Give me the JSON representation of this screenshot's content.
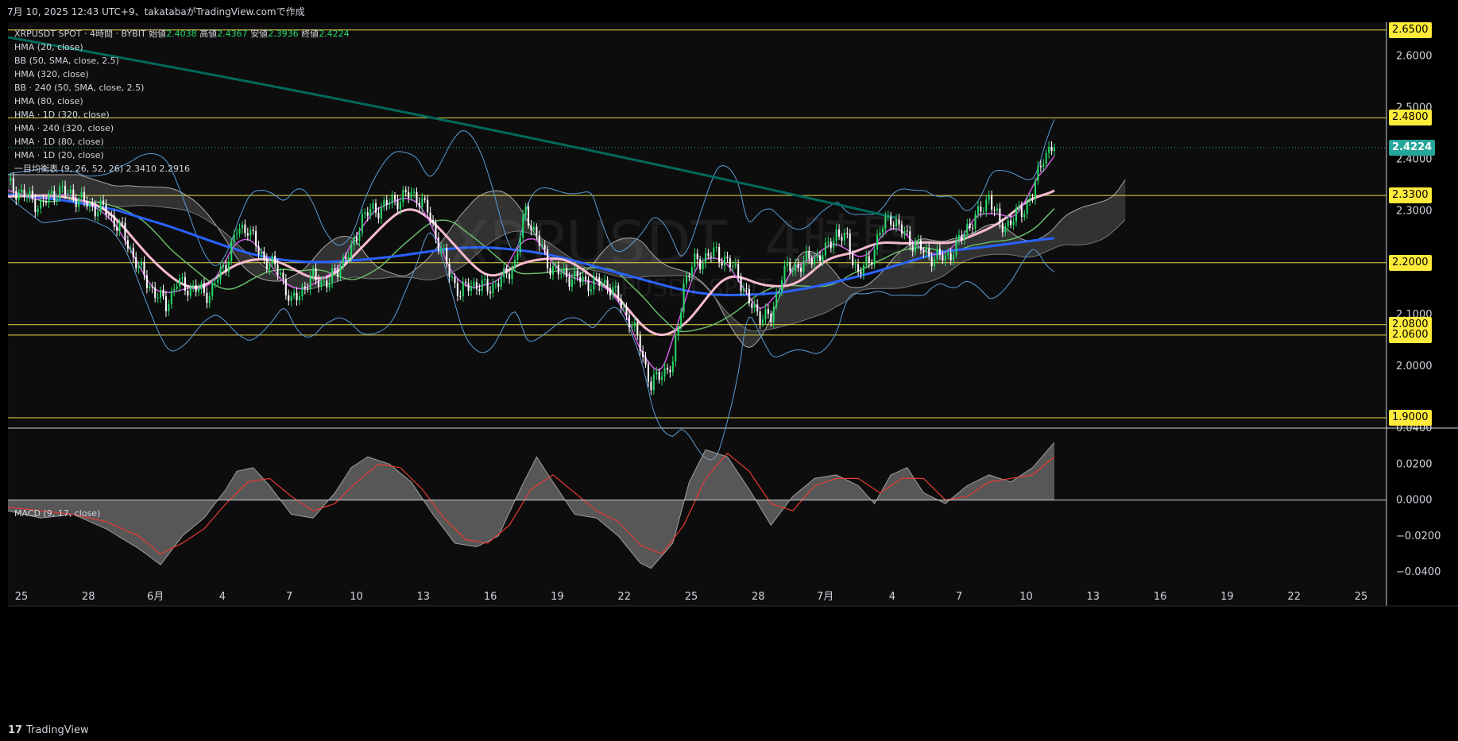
{
  "header": {
    "title": "7月 10, 2025 12:43 UTC+9、takatabaがTradingView.comで作成"
  },
  "legend": {
    "symbol": "XRPUSDT SPOT · 4時間 · BYBIT",
    "ohlc_labels": {
      "open": "始値",
      "high": "高値",
      "low": "安値",
      "close": "終値"
    },
    "ohlc_values": {
      "open": "2.4038",
      "high": "2.4367",
      "low": "2.3936",
      "close": "2.4224"
    },
    "indicators": [
      "HMA (20, close)",
      "BB (50, SMA, close, 2.5)",
      "HMA (320, close)",
      "BB · 240 (50, SMA, close, 2.5)",
      "HMA (80, close)",
      "HMA · 1D (320, close)",
      "HMA · 240 (320, close)",
      "HMA · 1D (80, close)",
      "HMA · 1D (20, close)"
    ],
    "ichimoku": "一目均衡表 (9, 26, 52, 26)",
    "ichimoku_values": "2.3410  2.2916"
  },
  "watermark": {
    "main": "XRPUSDT, 4時間",
    "sub": "XRPUSDT SPOT"
  },
  "macd_legend": "MACD (9, 17, close)",
  "footer": {
    "brand": "TradingView",
    "mark": "17"
  },
  "colors": {
    "background": "#0d0d0d",
    "candle_up": "#26d968",
    "candle_down": "#ffffff",
    "hline": "#e8d94a",
    "hma320": "#2962ff",
    "hma80": "#f8bbd0",
    "hma20": "#d05ce3",
    "long_hma": "#00695c",
    "bb": "#5b9bd5",
    "green_ma": "#66bb6a",
    "price_tag": "#ffeb3b",
    "last_tag": "#26a69a"
  },
  "chart_data": [
    {
      "type": "candlestick",
      "symbol": "XRPUSDT SPOT",
      "timeframe": "4時間",
      "y_axis_ticks": [
        "2.6000",
        "2.5000",
        "2.4000",
        "2.3000",
        "2.1000",
        "2.0000"
      ],
      "ylim": [
        1.88,
        2.665
      ],
      "x_axis_ticks": [
        "25",
        "28",
        "6月",
        "4",
        "7",
        "10",
        "13",
        "16",
        "19",
        "22",
        "25",
        "28",
        "7月",
        "4",
        "7",
        "10",
        "13",
        "16",
        "19",
        "22",
        "25"
      ],
      "horizontal_lines": [
        2.65,
        2.48,
        2.33,
        2.2,
        2.08,
        2.06,
        1.9
      ],
      "price_labels": [
        "2.6500",
        "2.4800",
        "2.3300",
        "2.2000",
        "2.0800",
        "2.0600",
        "1.9000"
      ],
      "last_price": "2.4224",
      "path_points": [
        [
          0,
          2.35
        ],
        [
          6,
          2.33
        ],
        [
          12,
          2.31
        ],
        [
          18,
          2.34
        ],
        [
          24,
          2.33
        ],
        [
          30,
          2.31
        ],
        [
          36,
          2.3
        ],
        [
          42,
          2.26
        ],
        [
          48,
          2.19
        ],
        [
          54,
          2.14
        ],
        [
          58,
          2.12
        ],
        [
          62,
          2.16
        ],
        [
          68,
          2.15
        ],
        [
          74,
          2.14
        ],
        [
          80,
          2.2
        ],
        [
          84,
          2.26
        ],
        [
          88,
          2.27
        ],
        [
          92,
          2.22
        ],
        [
          96,
          2.2
        ],
        [
          100,
          2.18
        ],
        [
          104,
          2.12
        ],
        [
          108,
          2.15
        ],
        [
          112,
          2.17
        ],
        [
          118,
          2.16
        ],
        [
          122,
          2.2
        ],
        [
          126,
          2.22
        ],
        [
          130,
          2.29
        ],
        [
          134,
          2.3
        ],
        [
          138,
          2.31
        ],
        [
          142,
          2.32
        ],
        [
          146,
          2.33
        ],
        [
          150,
          2.33
        ],
        [
          154,
          2.3
        ],
        [
          158,
          2.24
        ],
        [
          162,
          2.18
        ],
        [
          166,
          2.14
        ],
        [
          170,
          2.16
        ],
        [
          176,
          2.15
        ],
        [
          182,
          2.17
        ],
        [
          186,
          2.2
        ],
        [
          190,
          2.3
        ],
        [
          194,
          2.25
        ],
        [
          198,
          2.2
        ],
        [
          202,
          2.18
        ],
        [
          208,
          2.17
        ],
        [
          214,
          2.16
        ],
        [
          220,
          2.16
        ],
        [
          224,
          2.13
        ],
        [
          228,
          2.09
        ],
        [
          232,
          2.04
        ],
        [
          236,
          1.96
        ],
        [
          240,
          1.99
        ],
        [
          244,
          2.0
        ],
        [
          248,
          2.16
        ],
        [
          252,
          2.2
        ],
        [
          256,
          2.21
        ],
        [
          260,
          2.22
        ],
        [
          264,
          2.2
        ],
        [
          268,
          2.18
        ],
        [
          272,
          2.12
        ],
        [
          276,
          2.1
        ],
        [
          280,
          2.09
        ],
        [
          284,
          2.18
        ],
        [
          288,
          2.19
        ],
        [
          292,
          2.2
        ],
        [
          296,
          2.21
        ],
        [
          300,
          2.22
        ],
        [
          304,
          2.26
        ],
        [
          308,
          2.24
        ],
        [
          312,
          2.18
        ],
        [
          316,
          2.2
        ],
        [
          320,
          2.26
        ],
        [
          324,
          2.29
        ],
        [
          328,
          2.26
        ],
        [
          332,
          2.24
        ],
        [
          336,
          2.22
        ],
        [
          340,
          2.21
        ],
        [
          344,
          2.21
        ],
        [
          348,
          2.23
        ],
        [
          352,
          2.27
        ],
        [
          356,
          2.29
        ],
        [
          360,
          2.33
        ],
        [
          364,
          2.27
        ],
        [
          368,
          2.28
        ],
        [
          372,
          2.3
        ],
        [
          376,
          2.33
        ],
        [
          380,
          2.41
        ],
        [
          384,
          2.4224
        ]
      ]
    },
    {
      "type": "area",
      "name": "MACD (9, 17, close)",
      "y_axis_ticks": [
        "0.0400",
        "0.0200",
        "0.0000",
        "−0.0200",
        "−0.0400"
      ],
      "ylim": [
        -0.047,
        0.04
      ],
      "macd_points": [
        [
          0,
          -0.006
        ],
        [
          12,
          -0.01
        ],
        [
          24,
          -0.008
        ],
        [
          36,
          -0.016
        ],
        [
          48,
          -0.027
        ],
        [
          56,
          -0.036
        ],
        [
          64,
          -0.02
        ],
        [
          72,
          -0.01
        ],
        [
          80,
          0.006
        ],
        [
          84,
          0.016
        ],
        [
          90,
          0.018
        ],
        [
          96,
          0.008
        ],
        [
          104,
          -0.008
        ],
        [
          112,
          -0.01
        ],
        [
          120,
          0.004
        ],
        [
          126,
          0.018
        ],
        [
          132,
          0.024
        ],
        [
          140,
          0.02
        ],
        [
          148,
          0.01
        ],
        [
          156,
          -0.008
        ],
        [
          164,
          -0.024
        ],
        [
          172,
          -0.026
        ],
        [
          180,
          -0.02
        ],
        [
          188,
          0.006
        ],
        [
          194,
          0.024
        ],
        [
          200,
          0.01
        ],
        [
          208,
          -0.008
        ],
        [
          216,
          -0.01
        ],
        [
          224,
          -0.02
        ],
        [
          232,
          -0.035
        ],
        [
          236,
          -0.038
        ],
        [
          244,
          -0.024
        ],
        [
          250,
          0.01
        ],
        [
          256,
          0.028
        ],
        [
          264,
          0.024
        ],
        [
          272,
          0.006
        ],
        [
          280,
          -0.014
        ],
        [
          288,
          0.002
        ],
        [
          296,
          0.012
        ],
        [
          304,
          0.014
        ],
        [
          312,
          0.008
        ],
        [
          318,
          -0.002
        ],
        [
          324,
          0.014
        ],
        [
          330,
          0.018
        ],
        [
          336,
          0.004
        ],
        [
          344,
          -0.002
        ],
        [
          352,
          0.008
        ],
        [
          360,
          0.014
        ],
        [
          368,
          0.01
        ],
        [
          376,
          0.018
        ],
        [
          384,
          0.032
        ]
      ],
      "signal_points": [
        [
          0,
          -0.004
        ],
        [
          12,
          -0.006
        ],
        [
          24,
          -0.008
        ],
        [
          36,
          -0.012
        ],
        [
          48,
          -0.02
        ],
        [
          56,
          -0.03
        ],
        [
          64,
          -0.024
        ],
        [
          72,
          -0.016
        ],
        [
          80,
          -0.002
        ],
        [
          88,
          0.01
        ],
        [
          96,
          0.012
        ],
        [
          104,
          0.002
        ],
        [
          112,
          -0.006
        ],
        [
          120,
          -0.002
        ],
        [
          128,
          0.01
        ],
        [
          136,
          0.02
        ],
        [
          144,
          0.018
        ],
        [
          152,
          0.006
        ],
        [
          160,
          -0.01
        ],
        [
          168,
          -0.022
        ],
        [
          176,
          -0.024
        ],
        [
          184,
          -0.014
        ],
        [
          192,
          0.006
        ],
        [
          200,
          0.014
        ],
        [
          208,
          0.004
        ],
        [
          216,
          -0.006
        ],
        [
          224,
          -0.012
        ],
        [
          232,
          -0.025
        ],
        [
          240,
          -0.03
        ],
        [
          248,
          -0.014
        ],
        [
          256,
          0.012
        ],
        [
          264,
          0.026
        ],
        [
          272,
          0.016
        ],
        [
          280,
          -0.002
        ],
        [
          288,
          -0.006
        ],
        [
          296,
          0.008
        ],
        [
          304,
          0.012
        ],
        [
          312,
          0.012
        ],
        [
          320,
          0.004
        ],
        [
          328,
          0.012
        ],
        [
          336,
          0.012
        ],
        [
          344,
          0.0
        ],
        [
          352,
          0.002
        ],
        [
          360,
          0.01
        ],
        [
          368,
          0.012
        ],
        [
          376,
          0.014
        ],
        [
          384,
          0.024
        ]
      ]
    }
  ]
}
